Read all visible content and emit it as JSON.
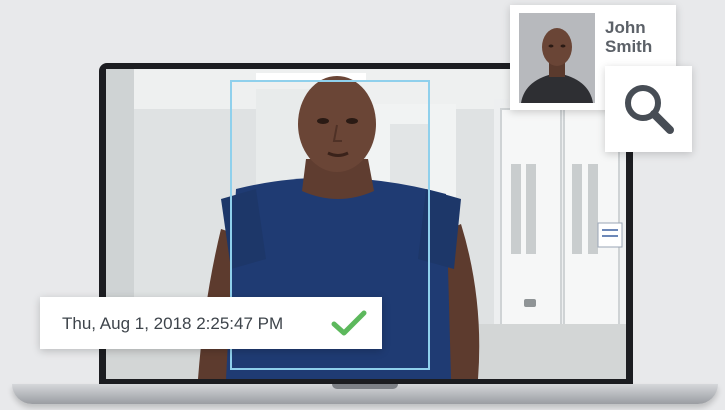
{
  "match": {
    "name": "John Smith",
    "photo_icon": "person-portrait-icon"
  },
  "search": {
    "icon": "search-icon"
  },
  "detection": {
    "timestamp": "Thu, Aug 1, 2018 2:25:47 PM",
    "status_icon": "checkmark-icon",
    "status_color": "#5cb85c"
  },
  "colors": {
    "face_box": "#8fd0ec",
    "shirt": "#1f3b73",
    "skin": "#6a4536"
  }
}
